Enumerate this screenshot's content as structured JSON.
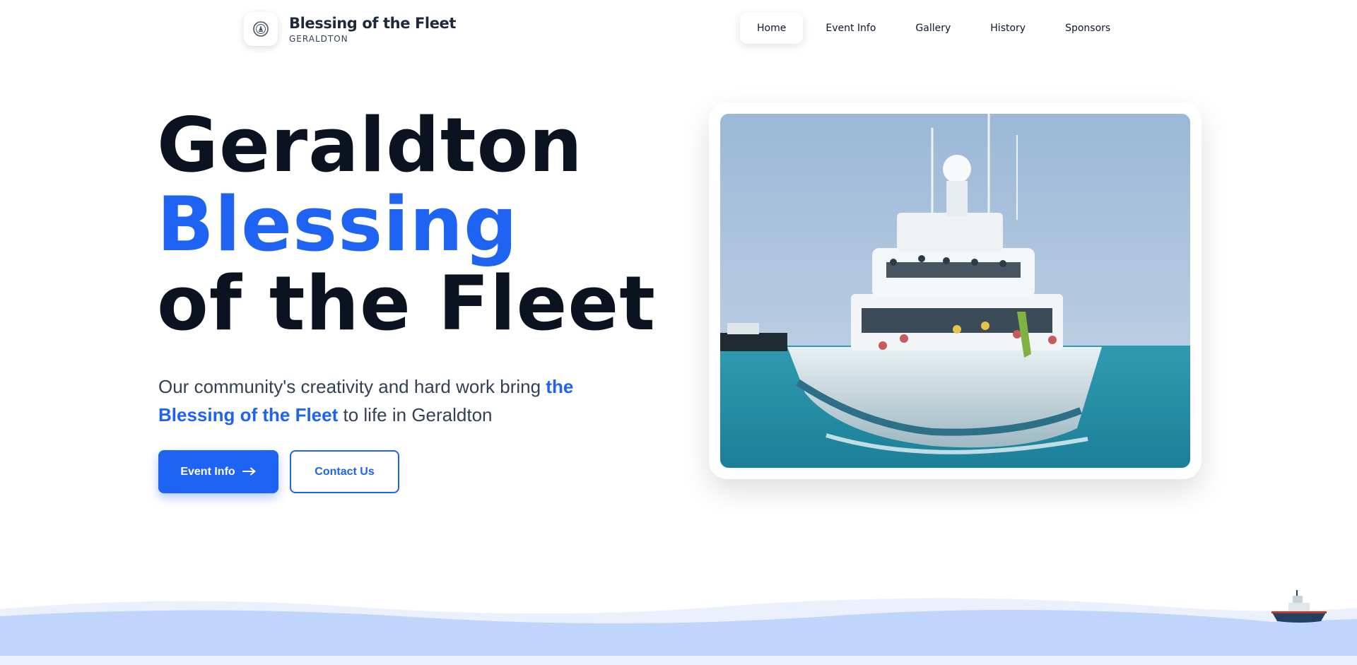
{
  "brand": {
    "title": "Blessing of the Fleet",
    "subtitle": "GERALDTON",
    "logo_icon": "anchor-badge-icon"
  },
  "nav": {
    "items": [
      {
        "label": "Home",
        "active": true
      },
      {
        "label": "Event Info",
        "active": false
      },
      {
        "label": "Gallery",
        "active": false
      },
      {
        "label": "History",
        "active": false
      },
      {
        "label": "Sponsors",
        "active": false
      }
    ]
  },
  "hero": {
    "title_line1": "Geraldton",
    "title_line2": "Blessing",
    "title_line3": "of the Fleet",
    "desc_before": "Our community's creativity and hard work bring ",
    "desc_highlight": "the Blessing of the Fleet",
    "desc_after": " to life in Geraldton",
    "primary_button": "Event Info",
    "primary_button_icon": "arrow-right-icon",
    "secondary_button": "Contact Us",
    "photo_icon": "fishing-boat-photo"
  },
  "colors": {
    "accent": "#1f63f2",
    "text": "#0b1220",
    "wave_light": "#eaf1fd",
    "wave_mid": "#bfd5fb"
  }
}
